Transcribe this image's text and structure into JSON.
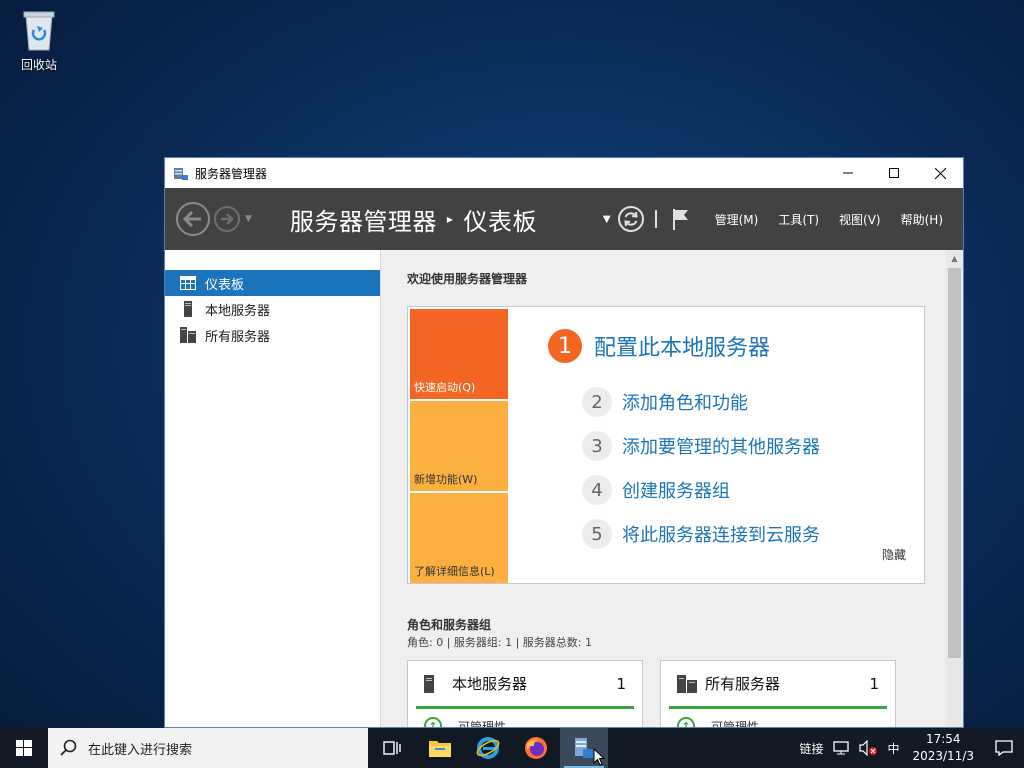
{
  "desktop": {
    "recycle_bin_label": "回收站"
  },
  "window": {
    "title": "服务器管理器",
    "breadcrumb": {
      "root": "服务器管理器",
      "separator": "▸",
      "current": "仪表板"
    },
    "menus": [
      "管理(M)",
      "工具(T)",
      "视图(V)",
      "帮助(H)"
    ]
  },
  "sidebar": {
    "items": [
      {
        "label": "仪表板",
        "active": true,
        "icon": "dashboard-icon"
      },
      {
        "label": "本地服务器",
        "active": false,
        "icon": "server-icon"
      },
      {
        "label": "所有服务器",
        "active": false,
        "icon": "servers-icon"
      }
    ]
  },
  "main": {
    "welcome_title": "欢迎使用服务器管理器",
    "tiles": [
      "快速启动(Q)",
      "新增功能(W)",
      "了解详细信息(L)"
    ],
    "steps": [
      {
        "num": "1",
        "label": "配置此本地服务器"
      },
      {
        "num": "2",
        "label": "添加角色和功能"
      },
      {
        "num": "3",
        "label": "添加要管理的其他服务器"
      },
      {
        "num": "4",
        "label": "创建服务器组"
      },
      {
        "num": "5",
        "label": "将此服务器连接到云服务"
      }
    ],
    "hide_label": "隐藏",
    "roles_title": "角色和服务器组",
    "roles_subtitle": "角色: 0 | 服务器组: 1 | 服务器总数: 1",
    "cards": [
      {
        "name": "本地服务器",
        "count": "1",
        "status": "可管理性"
      },
      {
        "name": "所有服务器",
        "count": "1",
        "status": "可管理性"
      }
    ]
  },
  "taskbar": {
    "search_placeholder": "在此键入进行搜索",
    "tray_links": "链接",
    "ime": "中",
    "time": "17:54",
    "date": "2023/11/3"
  },
  "colors": {
    "accent": "#1c75bc",
    "quick_start": "#f26522",
    "tile_secondary": "#fbb040",
    "toolbar": "#424242",
    "status_ok": "#3aa53a"
  }
}
